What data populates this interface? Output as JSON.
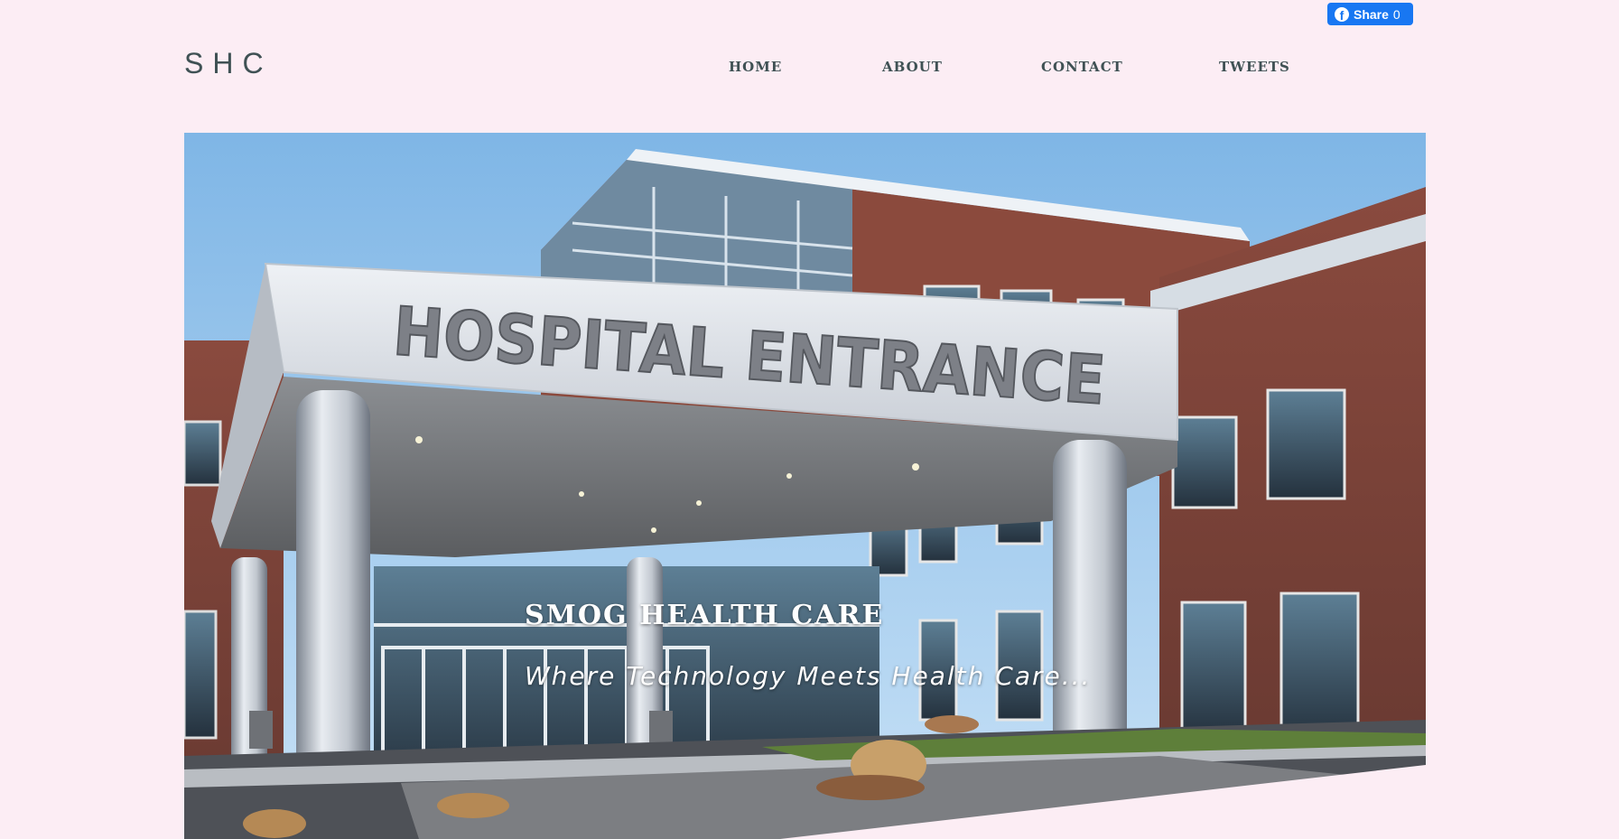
{
  "facebook": {
    "icon": "facebook-f-icon",
    "label": "Share",
    "count": "0",
    "color": "#1877f2"
  },
  "header": {
    "logo": "SHC"
  },
  "nav": {
    "items": [
      {
        "label": "HOME"
      },
      {
        "label": "ABOUT"
      },
      {
        "label": "CONTACT"
      },
      {
        "label": "TWEETS"
      }
    ]
  },
  "hero": {
    "sign_text": "HOSPITAL ENTRANCE",
    "title": "SMOG HEALTH CARE",
    "subtitle": "Where Technology Meets Health Care..."
  },
  "colors": {
    "background": "#fcedf4",
    "text": "#3f5154"
  }
}
